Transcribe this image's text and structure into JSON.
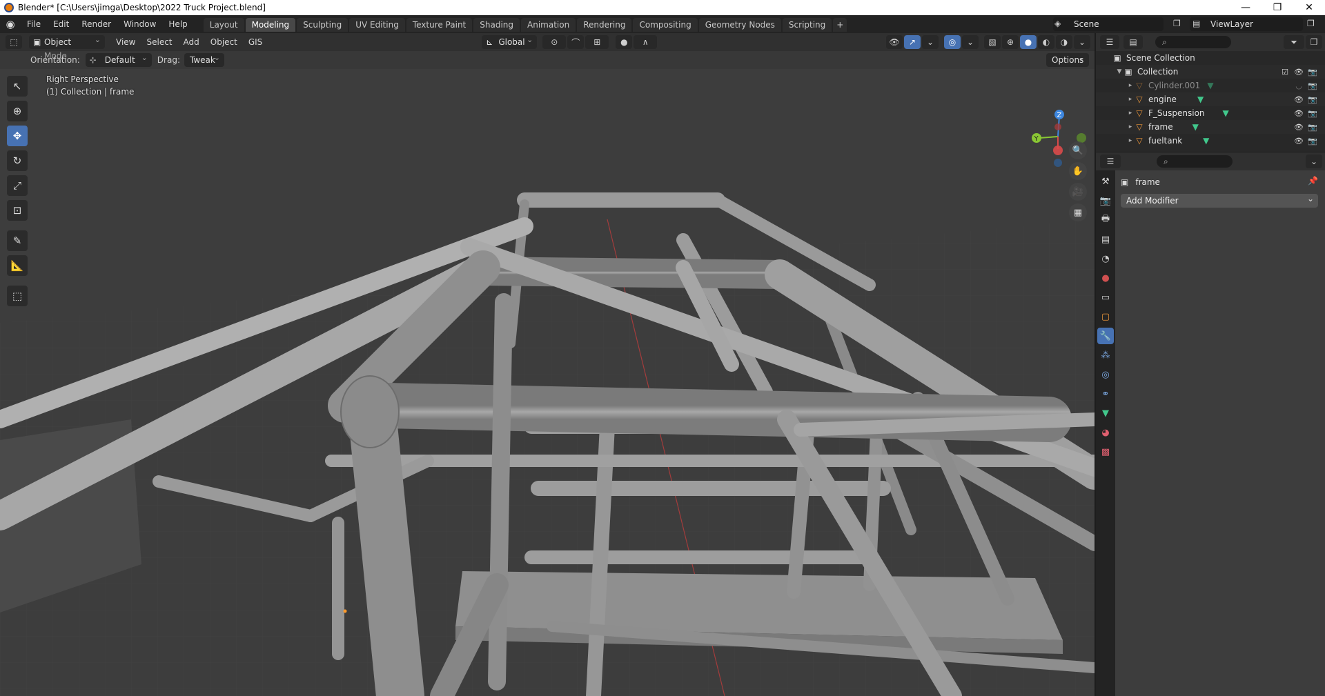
{
  "window": {
    "title": "Blender* [C:\\Users\\jimga\\Desktop\\2022 Truck Project.blend]",
    "controls": [
      "—",
      "❐",
      "✕"
    ]
  },
  "menu": [
    "File",
    "Edit",
    "Render",
    "Window",
    "Help"
  ],
  "workspaces": [
    "Layout",
    "Modeling",
    "Sculpting",
    "UV Editing",
    "Texture Paint",
    "Shading",
    "Animation",
    "Rendering",
    "Compositing",
    "Geometry Nodes",
    "Scripting"
  ],
  "active_workspace": "Modeling",
  "scene": {
    "name": "Scene",
    "view_layer": "ViewLayer"
  },
  "viewport": {
    "mode": "Object Mode",
    "menus": [
      "View",
      "Select",
      "Add",
      "Object",
      "GIS"
    ],
    "transform_orientation": "Global",
    "orientation_label": "Orientation:",
    "orientation_value": "Default",
    "drag_label": "Drag:",
    "drag_value": "Tweak",
    "options_label": "Options",
    "overlay_line1": "Right Perspective",
    "overlay_line2": "(1) Collection | frame",
    "gizmo": {
      "z": "Z",
      "y": "Y"
    }
  },
  "outliner": {
    "root": "Scene Collection",
    "collection": "Collection",
    "items": [
      {
        "name": "Cylinder.001",
        "dim": true
      },
      {
        "name": "engine",
        "dim": false
      },
      {
        "name": "F_Suspension",
        "dim": false
      },
      {
        "name": "frame",
        "dim": false
      },
      {
        "name": "fueltank",
        "dim": false
      }
    ]
  },
  "properties": {
    "object_name": "frame",
    "add_modifier": "Add Modifier"
  },
  "colors": {
    "accent": "#4772b3",
    "object_orange": "#e8943a",
    "mesh_green": "#41c88c",
    "axis_x": "#d94a4a",
    "axis_y": "#8ac734",
    "axis_z": "#3d87e0"
  }
}
